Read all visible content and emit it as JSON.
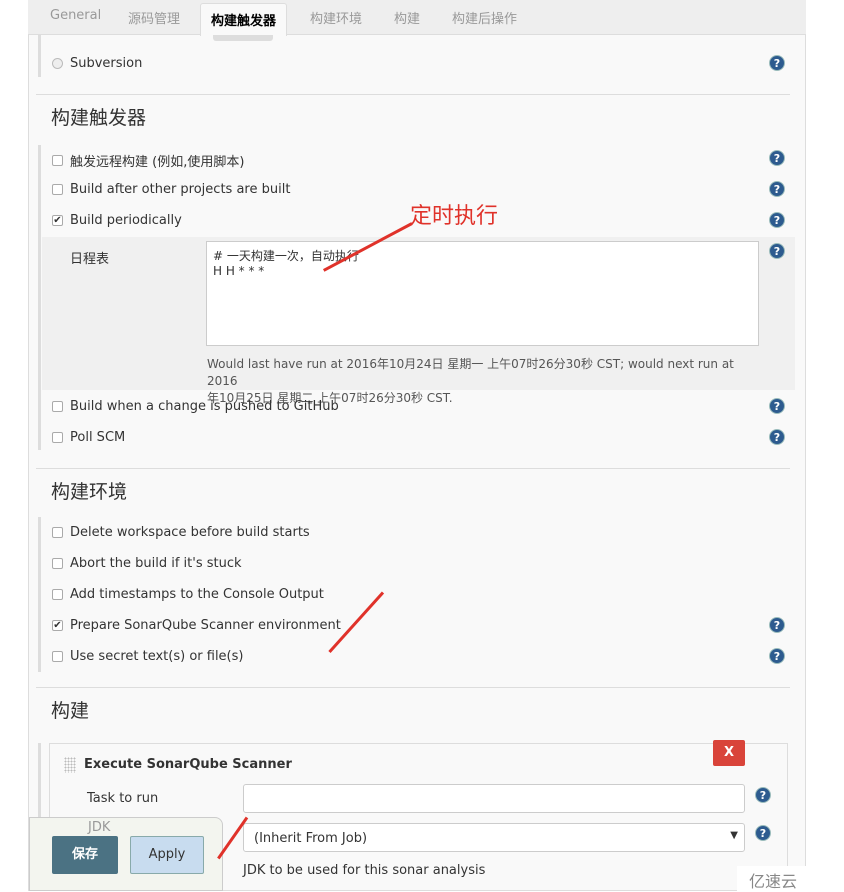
{
  "tabs": [
    "General",
    "源码管理",
    "构建触发器",
    "构建环境",
    "构建",
    "构建后操作"
  ],
  "active_tab": "构建触发器",
  "scm": {
    "subversion": "Subversion"
  },
  "triggers": {
    "title": "构建触发器",
    "items": [
      {
        "label": "触发远程构建 (例如,使用脚本)",
        "checked": false
      },
      {
        "label": "Build after other projects are built",
        "checked": false
      },
      {
        "label": "Build periodically",
        "checked": true
      },
      {
        "label": "Build when a change is pushed to GitHub",
        "checked": false
      },
      {
        "label": "Poll SCM",
        "checked": false
      }
    ],
    "schedule_label": "日程表",
    "schedule_value_line1": "# 一天构建一次，自动执行",
    "schedule_value_line2": "H H * * *",
    "schedule_info_line1": "Would last have run at 2016年10月24日 星期一 上午07时26分30秒 CST; would next run at 2016",
    "schedule_info_line2": "年10月25日 星期二 上午07时26分30秒 CST.",
    "annotation": "定时执行"
  },
  "env": {
    "title": "构建环境",
    "items": [
      {
        "label": "Delete workspace before build starts",
        "checked": false
      },
      {
        "label": "Abort the build if it's stuck",
        "checked": false
      },
      {
        "label": "Add timestamps to the Console Output",
        "checked": false
      },
      {
        "label": "Prepare SonarQube Scanner environment",
        "checked": true
      },
      {
        "label": "Use secret text(s) or file(s)",
        "checked": false
      }
    ]
  },
  "build": {
    "title": "构建",
    "step_title": "Execute SonarQube Scanner",
    "delete_label": "X",
    "task_label": "Task to run",
    "task_value": "",
    "jdk_label": "JDK",
    "jdk_value": "(Inherit From Job)",
    "jdk_help": "JDK to be used for this sonar analysis"
  },
  "footer": {
    "save": "保存",
    "apply": "Apply"
  },
  "watermark": "亿速云",
  "colors": {
    "annotation": "#e0322a",
    "save": "#4b7283",
    "apply": "#c8dcef",
    "delete": "#d9443a"
  }
}
